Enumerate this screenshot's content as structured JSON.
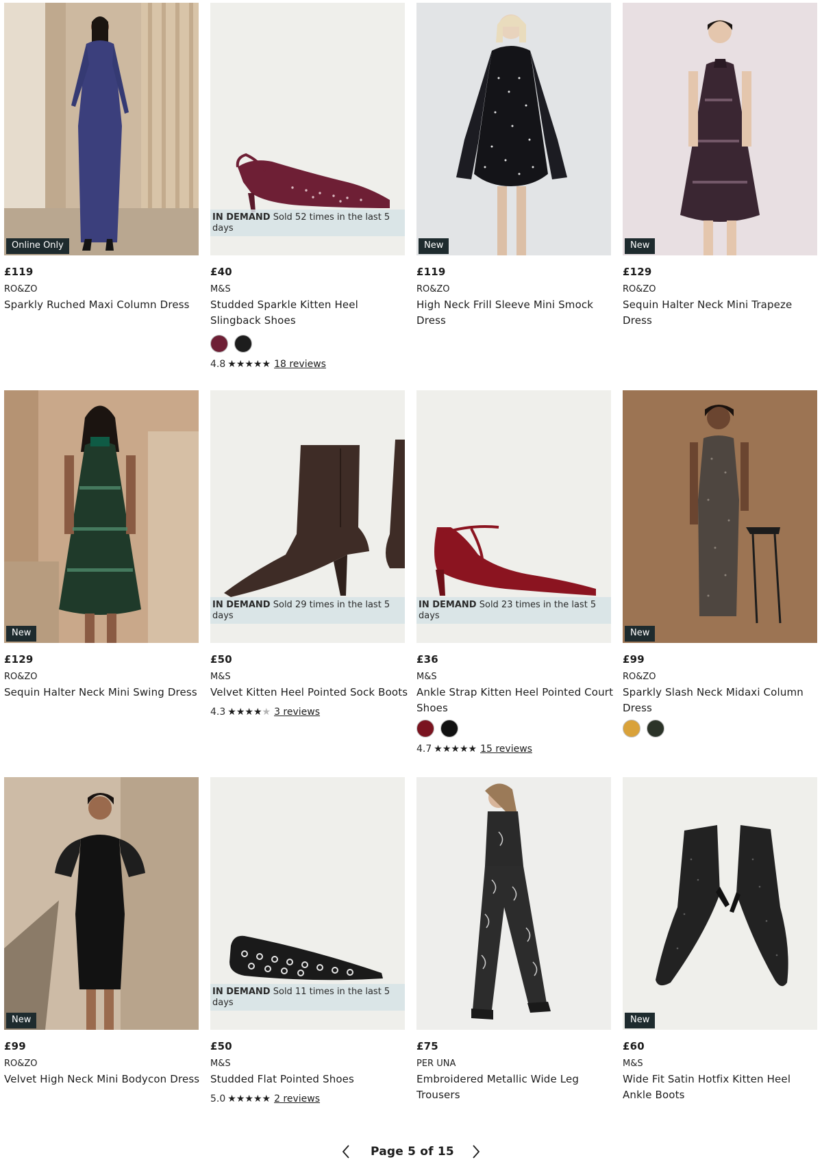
{
  "products": [
    {
      "price": "£119",
      "brand": "RO&ZO",
      "name": "Sparkly Ruched Maxi Column Dress",
      "badge": "Online Only",
      "image": "woman-sequin-maxi-dress"
    },
    {
      "price": "£40",
      "brand": "M&S",
      "name": "Studded Sparkle Kitten Heel Slingback Shoes",
      "demand_label": "IN DEMAND",
      "demand_text": "Sold 52 times in the last 5 days",
      "swatches": [
        "#6e1f35",
        "#1d1d1d"
      ],
      "rating": "4.8",
      "stars": 4.8,
      "reviews": "18 reviews",
      "image": "burgundy-slingback-shoe"
    },
    {
      "price": "£119",
      "brand": "RO&ZO",
      "name": "High Neck Frill Sleeve Mini Smock Dress",
      "badge": "New",
      "image": "woman-polka-dot-dress"
    },
    {
      "price": "£129",
      "brand": "RO&ZO",
      "name": "Sequin Halter Neck Mini Trapeze Dress",
      "badge": "New",
      "image": "woman-sequin-trapeze-dress"
    },
    {
      "price": "£129",
      "brand": "RO&ZO",
      "name": "Sequin Halter Neck Mini Swing Dress",
      "badge": "New",
      "image": "woman-green-sequin-dress"
    },
    {
      "price": "£50",
      "brand": "M&S",
      "name": "Velvet Kitten Heel Pointed Sock Boots",
      "demand_label": "IN DEMAND",
      "demand_text": "Sold 29 times in the last 5 days",
      "rating": "4.3",
      "stars": 4.3,
      "reviews": "3 reviews",
      "image": "velvet-sock-boot"
    },
    {
      "price": "£36",
      "brand": "M&S",
      "name": "Ankle Strap Kitten Heel Pointed Court Shoes",
      "demand_label": "IN DEMAND",
      "demand_text": "Sold 23 times in the last 5 days",
      "swatches": [
        "#7a1420",
        "#111111"
      ],
      "rating": "4.7",
      "stars": 4.7,
      "reviews": "15 reviews",
      "image": "red-patent-court-shoe"
    },
    {
      "price": "£99",
      "brand": "RO&ZO",
      "name": "Sparkly Slash Neck Midaxi Column Dress",
      "badge": "New",
      "swatches": [
        "#d9a23a",
        "#2b3328"
      ],
      "image": "woman-sparkly-midaxi-dress"
    },
    {
      "price": "£99",
      "brand": "RO&ZO",
      "name": "Velvet High Neck Mini Bodycon Dress",
      "badge": "New",
      "image": "woman-velvet-bodycon-dress"
    },
    {
      "price": "£50",
      "brand": "M&S",
      "name": "Studded Flat Pointed Shoes",
      "demand_label": "IN DEMAND",
      "demand_text": "Sold 11 times in the last 5 days",
      "rating": "5.0",
      "stars": 5.0,
      "reviews": "2 reviews",
      "image": "studded-flat-shoe"
    },
    {
      "price": "£75",
      "brand": "PER UNA",
      "name": "Embroidered Metallic Wide Leg Trousers",
      "image": "woman-metallic-trousers"
    },
    {
      "price": "£60",
      "brand": "M&S",
      "name": "Wide Fit Satin Hotfix Kitten Heel Ankle Boots",
      "badge": "New",
      "image": "hotfix-ankle-boots"
    }
  ],
  "pagination": {
    "label": "Page 5 of 15",
    "prev_icon": "chevron-left-icon",
    "next_icon": "chevron-right-icon"
  }
}
